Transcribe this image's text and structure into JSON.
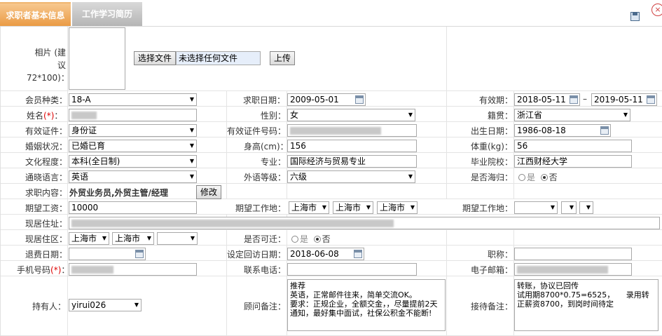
{
  "tabs": [
    "求职者基本信息",
    "工作学习简历"
  ],
  "photo": {
    "label": "相片 (建议72*100)：",
    "choose_btn": "选择文件",
    "no_file": "未选择任何文件",
    "upload_btn": "上传"
  },
  "labels": {
    "member_type": "会员种类：",
    "job_date": "求职日期：",
    "valid_period": "有效期：",
    "name": "姓名",
    "gender": "性别：",
    "native": "籍贯：",
    "id_type": "有效证件：",
    "id_no": "有效证件号码：",
    "birth": "出生日期：",
    "marriage": "婚姻状况：",
    "height": "身高(cm)：",
    "weight": "体重(kg)：",
    "education": "文化程度：",
    "major": "专业：",
    "school": "毕业院校：",
    "language": "通晓语言：",
    "foreign_level": "外语等级：",
    "returnee": "是否海归：",
    "job_content": "求职内容：",
    "salary": "期望工资：",
    "work_place": "期望工作地：",
    "work_place2": "期望工作地：",
    "address": "现居住址：",
    "area": "现居住区：",
    "relocate": "是否可迁：",
    "refund_date": "退费日期：",
    "revisit_date": "设定回访日期：",
    "title": "职称：",
    "mobile": "手机号码",
    "phone": "联系电话：",
    "email": "电子邮箱：",
    "holder": "持有人：",
    "advisor_note": "顾问备注：",
    "reception_note": "接待备注："
  },
  "required_mark": "(*)",
  "values": {
    "member_type": "18-A",
    "job_date": "2009-05-01",
    "valid_from": "2018-05-11",
    "valid_sep": "–",
    "valid_to": "2019-05-11",
    "gender": "女",
    "native": "浙江省",
    "id_type": "身份证",
    "birth": "1986-08-18",
    "marriage": "已婚已育",
    "height": "156",
    "weight": "56",
    "education": "本科(全日制)",
    "major": "国际经济与贸易专业",
    "school": "江西财经大学",
    "language": "英语",
    "foreign_level": "六级",
    "returnee_yes": "是",
    "returnee_no": "否",
    "job_content": "外贸业务员,外贸主管/经理",
    "modify_btn": "修改",
    "salary": "10000",
    "city1": "上海市",
    "city2": "上海市",
    "city3": "上海市",
    "area1": "上海市",
    "area2": "上海市",
    "relocate_yes": "是",
    "relocate_no": "否",
    "revisit_date": "2018-06-08",
    "holder": "yirui026",
    "advisor_note": "推荐\n英语，正常邮件往来，简单交流OK。\n要求：正规企业，全额交金，，尽量提前2天通知，最好集中面试，社保公积金不能断!",
    "reception_note": "转账，协议已回传\n试用期8700*0.75=6525，　　录用转正薪资8700，到岗时间待定"
  }
}
